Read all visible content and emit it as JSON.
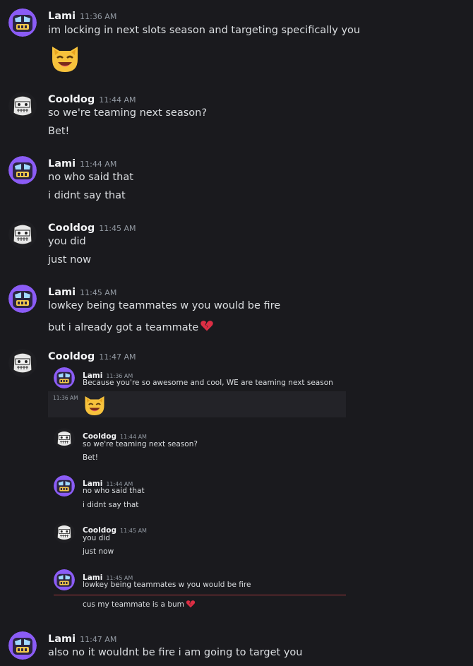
{
  "colors": {
    "background": "#1a1a1e",
    "text": "#dbdee1",
    "author": "#f2f3f5",
    "timestamp": "#949ba4",
    "divider": "#a5383c",
    "lami_avatar": "#8b5cf6"
  },
  "users": {
    "lami": "Lami",
    "cooldog": "Cooldog"
  },
  "messages": [
    {
      "author": "Lami",
      "time": "11:36 AM",
      "lines": [
        "im locking in next slots season and targeting specifically you"
      ],
      "emoji": "grinning-cat-icon"
    },
    {
      "author": "Cooldog",
      "time": "11:44 AM",
      "lines": [
        "so we're teaming next season?",
        "Bet!"
      ]
    },
    {
      "author": "Lami",
      "time": "11:44 AM",
      "lines": [
        "no who said that",
        "i didnt say that"
      ]
    },
    {
      "author": "Cooldog",
      "time": "11:45 AM",
      "lines": [
        "you did",
        "just now"
      ]
    },
    {
      "author": "Lami",
      "time": "11:45 AM",
      "lines": [
        "lowkey being teammates w you would be fire",
        "but i already got a teammate"
      ],
      "emoji": "broken-heart-icon"
    },
    {
      "author": "Cooldog",
      "time": "11:47 AM",
      "lines": []
    },
    {
      "author": "Lami",
      "time": "11:47 AM",
      "lines": [
        "also no it wouldnt be fire i am going to target you"
      ]
    }
  ],
  "embedded": {
    "hover_time": "11:36 AM",
    "messages": [
      {
        "author": "Lami",
        "time": "11:36 AM",
        "lines": [
          "Because you're so awesome and cool, WE are teaming next season"
        ],
        "emoji": "grinning-cat-icon"
      },
      {
        "author": "Cooldog",
        "time": "11:44 AM",
        "lines": [
          "so we're teaming next season?",
          "Bet!"
        ]
      },
      {
        "author": "Lami",
        "time": "11:44 AM",
        "lines": [
          "no who said that",
          "i didnt say that"
        ]
      },
      {
        "author": "Cooldog",
        "time": "11:45 AM",
        "lines": [
          "you did",
          "just now"
        ]
      },
      {
        "author": "Lami",
        "time": "11:45 AM",
        "lines": [
          "lowkey being teammates w you would be fire",
          "cus my teammate is a bum"
        ],
        "emoji": "broken-heart-icon"
      }
    ]
  }
}
